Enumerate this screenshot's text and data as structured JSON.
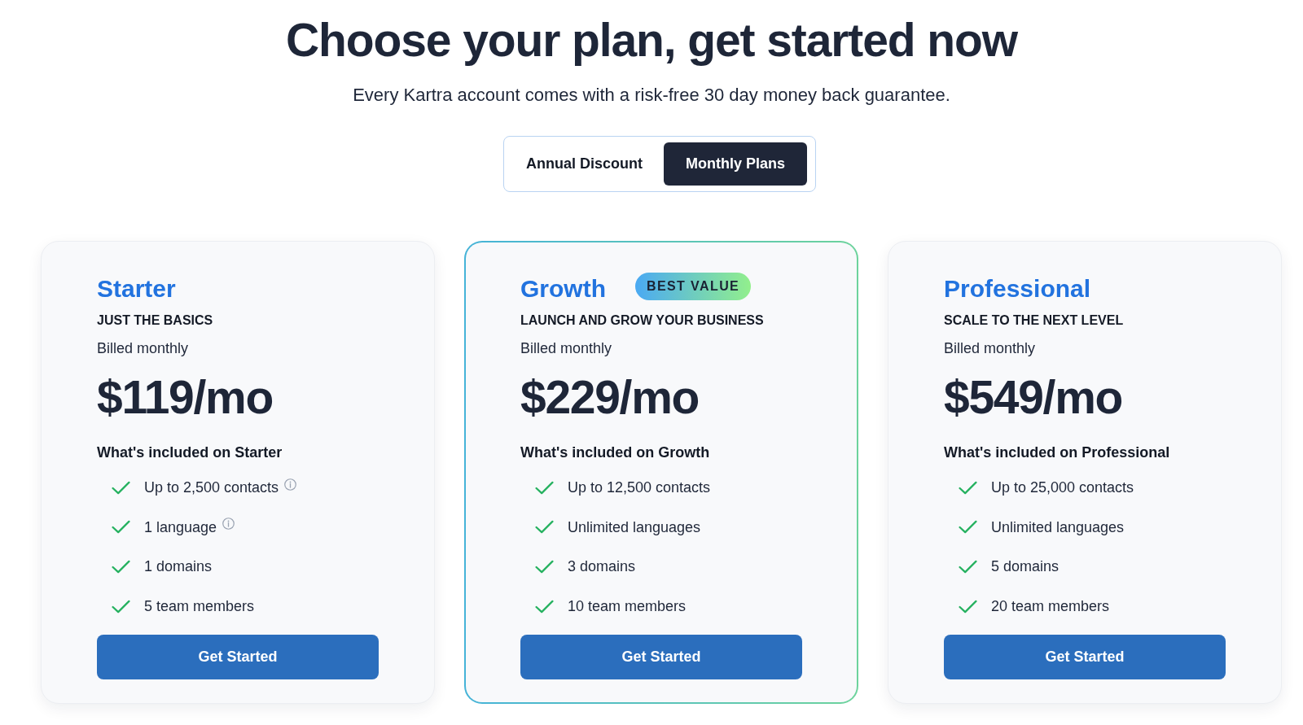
{
  "header": {
    "title": "Choose your plan, get started now",
    "subtitle": "Every Kartra account comes with a risk-free 30 day money back guarantee."
  },
  "billing_toggle": [
    {
      "label": "Annual Discount",
      "selected": false
    },
    {
      "label": "Monthly Plans",
      "selected": true
    }
  ],
  "plans": [
    {
      "name": "Starter",
      "featured": false,
      "tagline": "JUST THE BASICS",
      "billing": "Billed monthly",
      "price": "$119/mo",
      "included_heading": "What's included on Starter",
      "features": [
        {
          "text": "Up to 2,500 contacts",
          "info": true
        },
        {
          "text": "1 language",
          "info": true
        },
        {
          "text": "1 domains",
          "info": false
        },
        {
          "text": "5 team members",
          "info": false
        }
      ],
      "button": "Get Started"
    },
    {
      "name": "Growth",
      "featured": true,
      "badge": "BEST VALUE",
      "tagline": "LAUNCH AND GROW YOUR BUSINESS",
      "billing": "Billed monthly",
      "price": "$229/mo",
      "included_heading": "What's included on Growth",
      "features": [
        {
          "text": "Up to 12,500 contacts",
          "info": false
        },
        {
          "text": "Unlimited languages",
          "info": false
        },
        {
          "text": "3 domains",
          "info": false
        },
        {
          "text": "10 team members",
          "info": false
        }
      ],
      "button": "Get Started"
    },
    {
      "name": "Professional",
      "featured": false,
      "tagline": "SCALE TO THE NEXT LEVEL",
      "billing": "Billed monthly",
      "price": "$549/mo",
      "included_heading": "What's included on Professional",
      "features": [
        {
          "text": "Up to 25,000 contacts",
          "info": false
        },
        {
          "text": "Unlimited languages",
          "info": false
        },
        {
          "text": "5 domains",
          "info": false
        },
        {
          "text": "20 team members",
          "info": false
        }
      ],
      "button": "Get Started"
    }
  ]
}
